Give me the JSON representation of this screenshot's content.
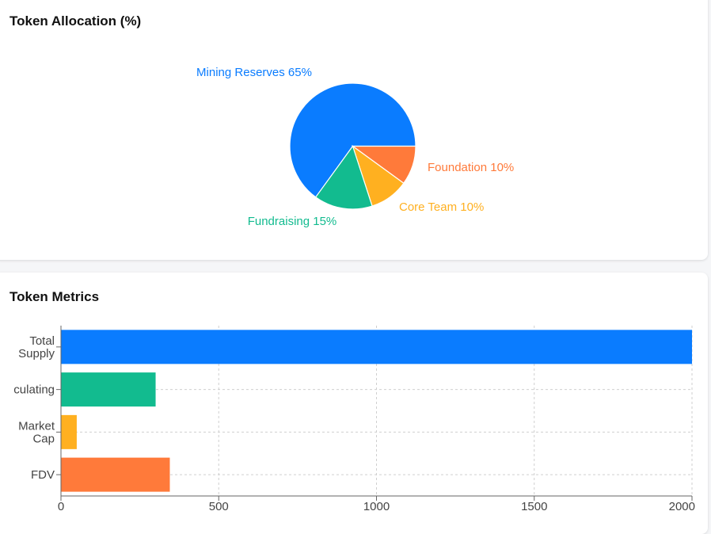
{
  "allocation": {
    "title": "Token Allocation (%)"
  },
  "metrics": {
    "title": "Token Metrics"
  },
  "colors": {
    "blue": "#0a7cff",
    "green": "#12bb8f",
    "yellow": "#ffb020",
    "orange": "#ff7a3a"
  },
  "chart_data": [
    {
      "type": "pie",
      "title": "Token Allocation (%)",
      "slices": [
        {
          "label": "Mining Reserves",
          "value": 65,
          "display": "Mining Reserves 65%",
          "color": "#0a7cff"
        },
        {
          "label": "Foundation",
          "value": 10,
          "display": "Foundation 10%",
          "color": "#ff7a3a"
        },
        {
          "label": "Core Team",
          "value": 10,
          "display": "Core Team 10%",
          "color": "#ffb020"
        },
        {
          "label": "Fundraising",
          "value": 15,
          "display": "Fundraising 15%",
          "color": "#12bb8f"
        }
      ]
    },
    {
      "type": "bar",
      "orientation": "horizontal",
      "title": "Token Metrics",
      "categories": [
        [
          "Total",
          "Supply"
        ],
        [
          "culating"
        ],
        [
          "Market",
          "Cap"
        ],
        [
          "FDV"
        ]
      ],
      "values": [
        2000,
        300,
        50,
        345
      ],
      "colors": [
        "#0a7cff",
        "#12bb8f",
        "#ffb020",
        "#ff7a3a"
      ],
      "xlim": [
        0,
        2000
      ],
      "xticks": [
        0,
        500,
        1000,
        1500,
        2000
      ],
      "grid": true
    }
  ]
}
